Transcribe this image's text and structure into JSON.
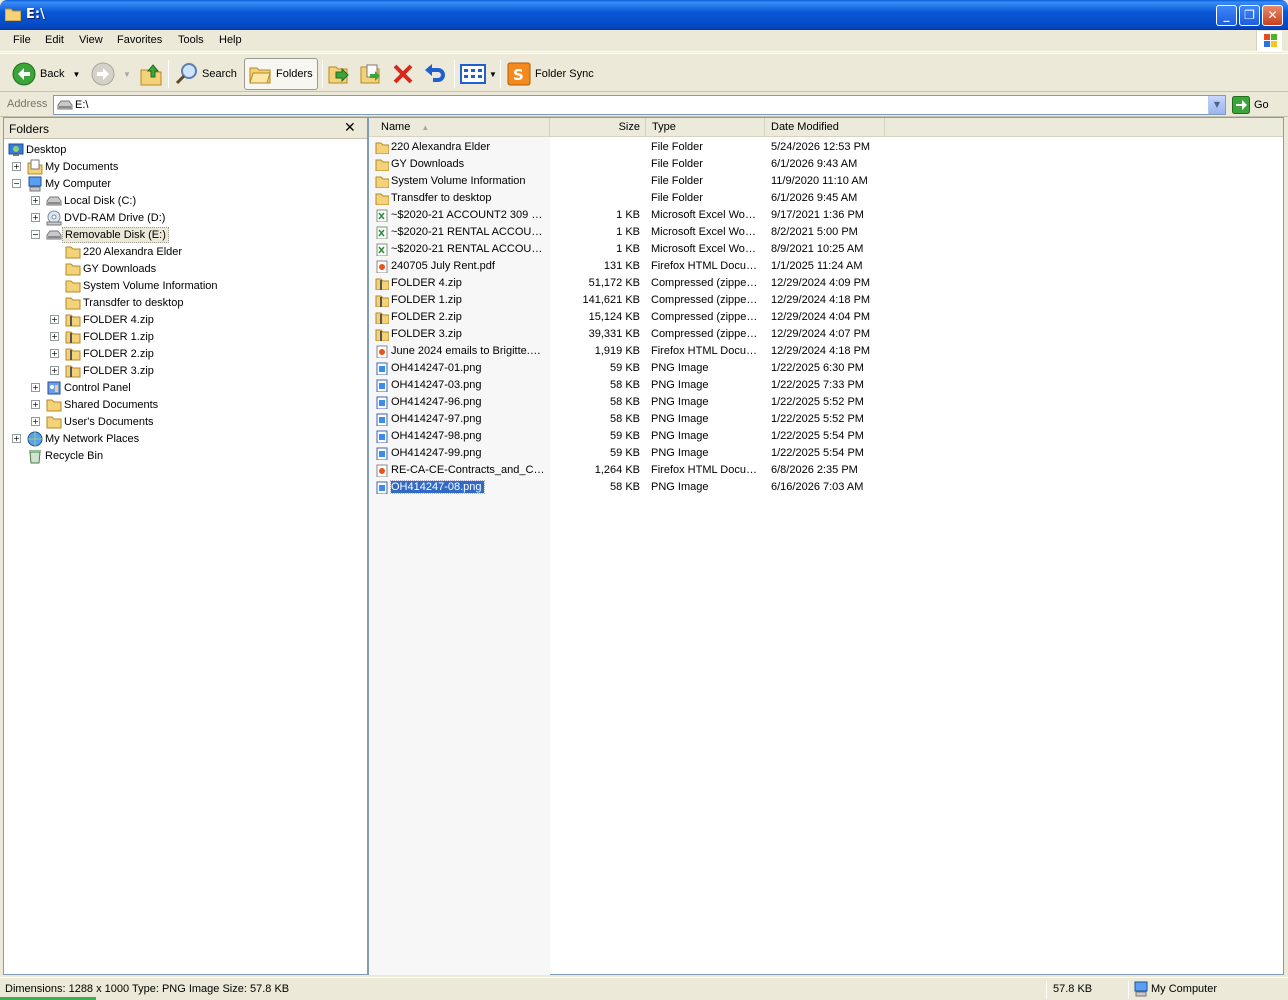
{
  "window": {
    "title": "E:\\"
  },
  "menu": [
    "File",
    "Edit",
    "View",
    "Favorites",
    "Tools",
    "Help"
  ],
  "toolbar": {
    "back": "Back",
    "search": "Search",
    "folders": "Folders",
    "folder_sync": "Folder Sync"
  },
  "address": {
    "label": "Address",
    "value": "E:\\",
    "go": "Go"
  },
  "folders_pane": {
    "title": "Folders",
    "tree": [
      {
        "label": "Desktop",
        "icon": "desktop-icon"
      },
      {
        "label": "My Documents",
        "icon": "my-documents-icon"
      },
      {
        "label": "My Computer",
        "icon": "my-computer-icon"
      },
      {
        "label": "Local Disk (C:)",
        "icon": "hard-disk-icon"
      },
      {
        "label": "DVD-RAM Drive (D:)",
        "icon": "dvd-drive-icon"
      },
      {
        "label": "Removable Disk (E:)",
        "icon": "removable-disk-icon"
      },
      {
        "label": "220  Alexandra Elder",
        "icon": "folder-icon"
      },
      {
        "label": "GY Downloads",
        "icon": "folder-icon"
      },
      {
        "label": "System Volume Information",
        "icon": "folder-icon"
      },
      {
        "label": "Transdfer to desktop",
        "icon": "folder-icon"
      },
      {
        "label": "FOLDER 4.zip",
        "icon": "zip-folder-icon"
      },
      {
        "label": "FOLDER  1.zip",
        "icon": "zip-folder-icon"
      },
      {
        "label": "FOLDER  2.zip",
        "icon": "zip-folder-icon"
      },
      {
        "label": "FOLDER  3.zip",
        "icon": "zip-folder-icon"
      },
      {
        "label": "Control Panel",
        "icon": "control-panel-icon"
      },
      {
        "label": "Shared Documents",
        "icon": "folder-icon"
      },
      {
        "label": "User's Documents",
        "icon": "folder-icon"
      },
      {
        "label": "My Network Places",
        "icon": "network-places-icon"
      },
      {
        "label": "Recycle Bin",
        "icon": "recycle-bin-icon"
      }
    ]
  },
  "list": {
    "columns": {
      "name": "Name",
      "size": "Size",
      "type": "Type",
      "date": "Date Modified"
    },
    "files": [
      {
        "name": "220  Alexandra Elder",
        "size": "",
        "type": "File Folder",
        "date": "5/24/2026 12:53 PM",
        "icon": "folder-icon"
      },
      {
        "name": "GY Downloads",
        "size": "",
        "type": "File Folder",
        "date": "6/1/2026 9:43 AM",
        "icon": "folder-icon"
      },
      {
        "name": "System Volume Information",
        "size": "",
        "type": "File Folder",
        "date": "11/9/2020 11:10 AM",
        "icon": "folder-icon"
      },
      {
        "name": "Transdfer to desktop",
        "size": "",
        "type": "File Folder",
        "date": "6/1/2026 9:45 AM",
        "icon": "folder-icon"
      },
      {
        "name": "~$2020-21  ACCOUNT2 309  …",
        "size": "1 KB",
        "type": "Microsoft Excel Wor…",
        "date": "9/17/2021 1:36 PM",
        "icon": "excel-file-icon"
      },
      {
        "name": "~$2020-21 RENTAL ACCOUN…",
        "size": "1 KB",
        "type": "Microsoft Excel Wor…",
        "date": "8/2/2021 5:00 PM",
        "icon": "excel-file-icon"
      },
      {
        "name": "~$2020-21 RENTAL ACCOUN…",
        "size": "1 KB",
        "type": "Microsoft Excel Wor…",
        "date": "8/9/2021 10:25 AM",
        "icon": "excel-file-icon"
      },
      {
        "name": "240705 July Rent.pdf",
        "size": "131 KB",
        "type": "Firefox HTML Docu…",
        "date": "1/1/2025 11:24 AM",
        "icon": "pdf-file-icon"
      },
      {
        "name": "FOLDER 4.zip",
        "size": "51,172 KB",
        "type": "Compressed (zippe…",
        "date": "12/29/2024 4:09 PM",
        "icon": "zip-file-icon"
      },
      {
        "name": "FOLDER  1.zip",
        "size": "141,621 KB",
        "type": "Compressed (zippe…",
        "date": "12/29/2024 4:18 PM",
        "icon": "zip-file-icon"
      },
      {
        "name": "FOLDER  2.zip",
        "size": "15,124 KB",
        "type": "Compressed (zippe…",
        "date": "12/29/2024 4:04 PM",
        "icon": "zip-file-icon"
      },
      {
        "name": "FOLDER  3.zip",
        "size": "39,331 KB",
        "type": "Compressed (zippe…",
        "date": "12/29/2024 4:07 PM",
        "icon": "zip-file-icon"
      },
      {
        "name": "June 2024 emails to Brigitte.pdf",
        "size": "1,919 KB",
        "type": "Firefox HTML Docu…",
        "date": "12/29/2024 4:18 PM",
        "icon": "pdf-file-icon"
      },
      {
        "name": "OH414247-01.png",
        "size": "59 KB",
        "type": "PNG Image",
        "date": "1/22/2025 6:30 PM",
        "icon": "png-file-icon"
      },
      {
        "name": "OH414247-03.png",
        "size": "58 KB",
        "type": "PNG Image",
        "date": "1/22/2025 7:33 PM",
        "icon": "png-file-icon"
      },
      {
        "name": "OH414247-96.png",
        "size": "58 KB",
        "type": "PNG Image",
        "date": "1/22/2025 5:52 PM",
        "icon": "png-file-icon"
      },
      {
        "name": "OH414247-97.png",
        "size": "58 KB",
        "type": "PNG Image",
        "date": "1/22/2025 5:52 PM",
        "icon": "png-file-icon"
      },
      {
        "name": "OH414247-98.png",
        "size": "59 KB",
        "type": "PNG Image",
        "date": "1/22/2025 5:54 PM",
        "icon": "png-file-icon"
      },
      {
        "name": "OH414247-99.png",
        "size": "59 KB",
        "type": "PNG Image",
        "date": "1/22/2025 5:54 PM",
        "icon": "png-file-icon"
      },
      {
        "name": "RE-CA-CE-Contracts_and_Co…",
        "size": "1,264 KB",
        "type": "Firefox HTML Docu…",
        "date": "6/8/2026 2:35 PM",
        "icon": "pdf-file-icon"
      },
      {
        "name": "OH414247-08.png",
        "size": "58 KB",
        "type": "PNG Image",
        "date": "6/16/2026 7:03 AM",
        "icon": "png-file-icon",
        "selected": true
      }
    ]
  },
  "status": {
    "left": "Dimensions: 1288 x 1000 Type: PNG Image Size: 57.8 KB",
    "size": "57.8 KB",
    "zone": "My Computer"
  }
}
